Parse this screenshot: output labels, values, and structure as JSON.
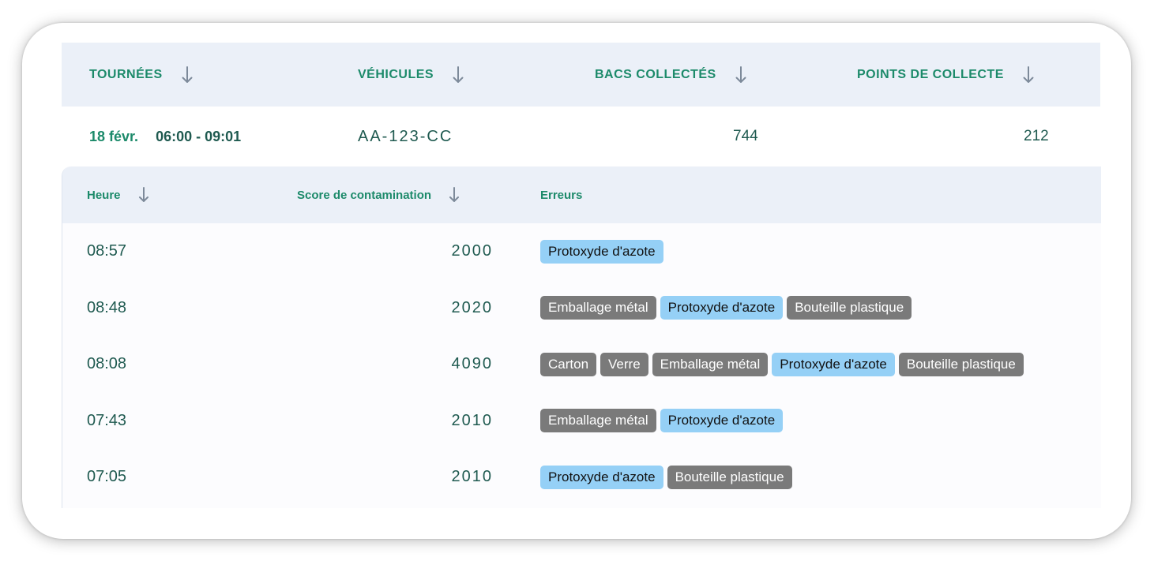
{
  "outer_table": {
    "headers": [
      "TOURNÉES",
      "VÉHICULES",
      "BACS COLLECTÉS",
      "POINTS DE COLLECTE"
    ],
    "row": {
      "date": "18 févr.",
      "time_range": "06:00 - 09:01",
      "vehicle": "AA-123-CC",
      "bins_collected": "744",
      "collection_points": "212"
    }
  },
  "inner_table": {
    "headers": {
      "time": "Heure",
      "score": "Score de contamination",
      "errors": "Erreurs"
    },
    "rows": [
      {
        "time": "08:57",
        "score": "2000",
        "errors": [
          {
            "label": "Protoxyde d'azote",
            "kind": "blue"
          }
        ]
      },
      {
        "time": "08:48",
        "score": "2020",
        "errors": [
          {
            "label": "Emballage métal",
            "kind": "gray"
          },
          {
            "label": "Protoxyde d'azote",
            "kind": "blue"
          },
          {
            "label": "Bouteille plastique",
            "kind": "gray"
          }
        ]
      },
      {
        "time": "08:08",
        "score": "4090",
        "errors": [
          {
            "label": "Carton",
            "kind": "gray"
          },
          {
            "label": "Verre",
            "kind": "gray"
          },
          {
            "label": "Emballage métal",
            "kind": "gray"
          },
          {
            "label": "Protoxyde d'azote",
            "kind": "blue"
          },
          {
            "label": "Bouteille plastique",
            "kind": "gray"
          }
        ]
      },
      {
        "time": "07:43",
        "score": "2010",
        "errors": [
          {
            "label": "Emballage métal",
            "kind": "gray"
          },
          {
            "label": "Protoxyde d'azote",
            "kind": "blue"
          }
        ]
      },
      {
        "time": "07:05",
        "score": "2010",
        "errors": [
          {
            "label": "Protoxyde d'azote",
            "kind": "blue"
          },
          {
            "label": "Bouteille plastique",
            "kind": "gray"
          }
        ]
      }
    ]
  },
  "colors": {
    "header_bg": "#ebf0f8",
    "header_text": "#1c8a6a",
    "body_text": "#1f5a50",
    "tag_blue": "#95d0f6",
    "tag_gray": "#7a7a7a"
  }
}
